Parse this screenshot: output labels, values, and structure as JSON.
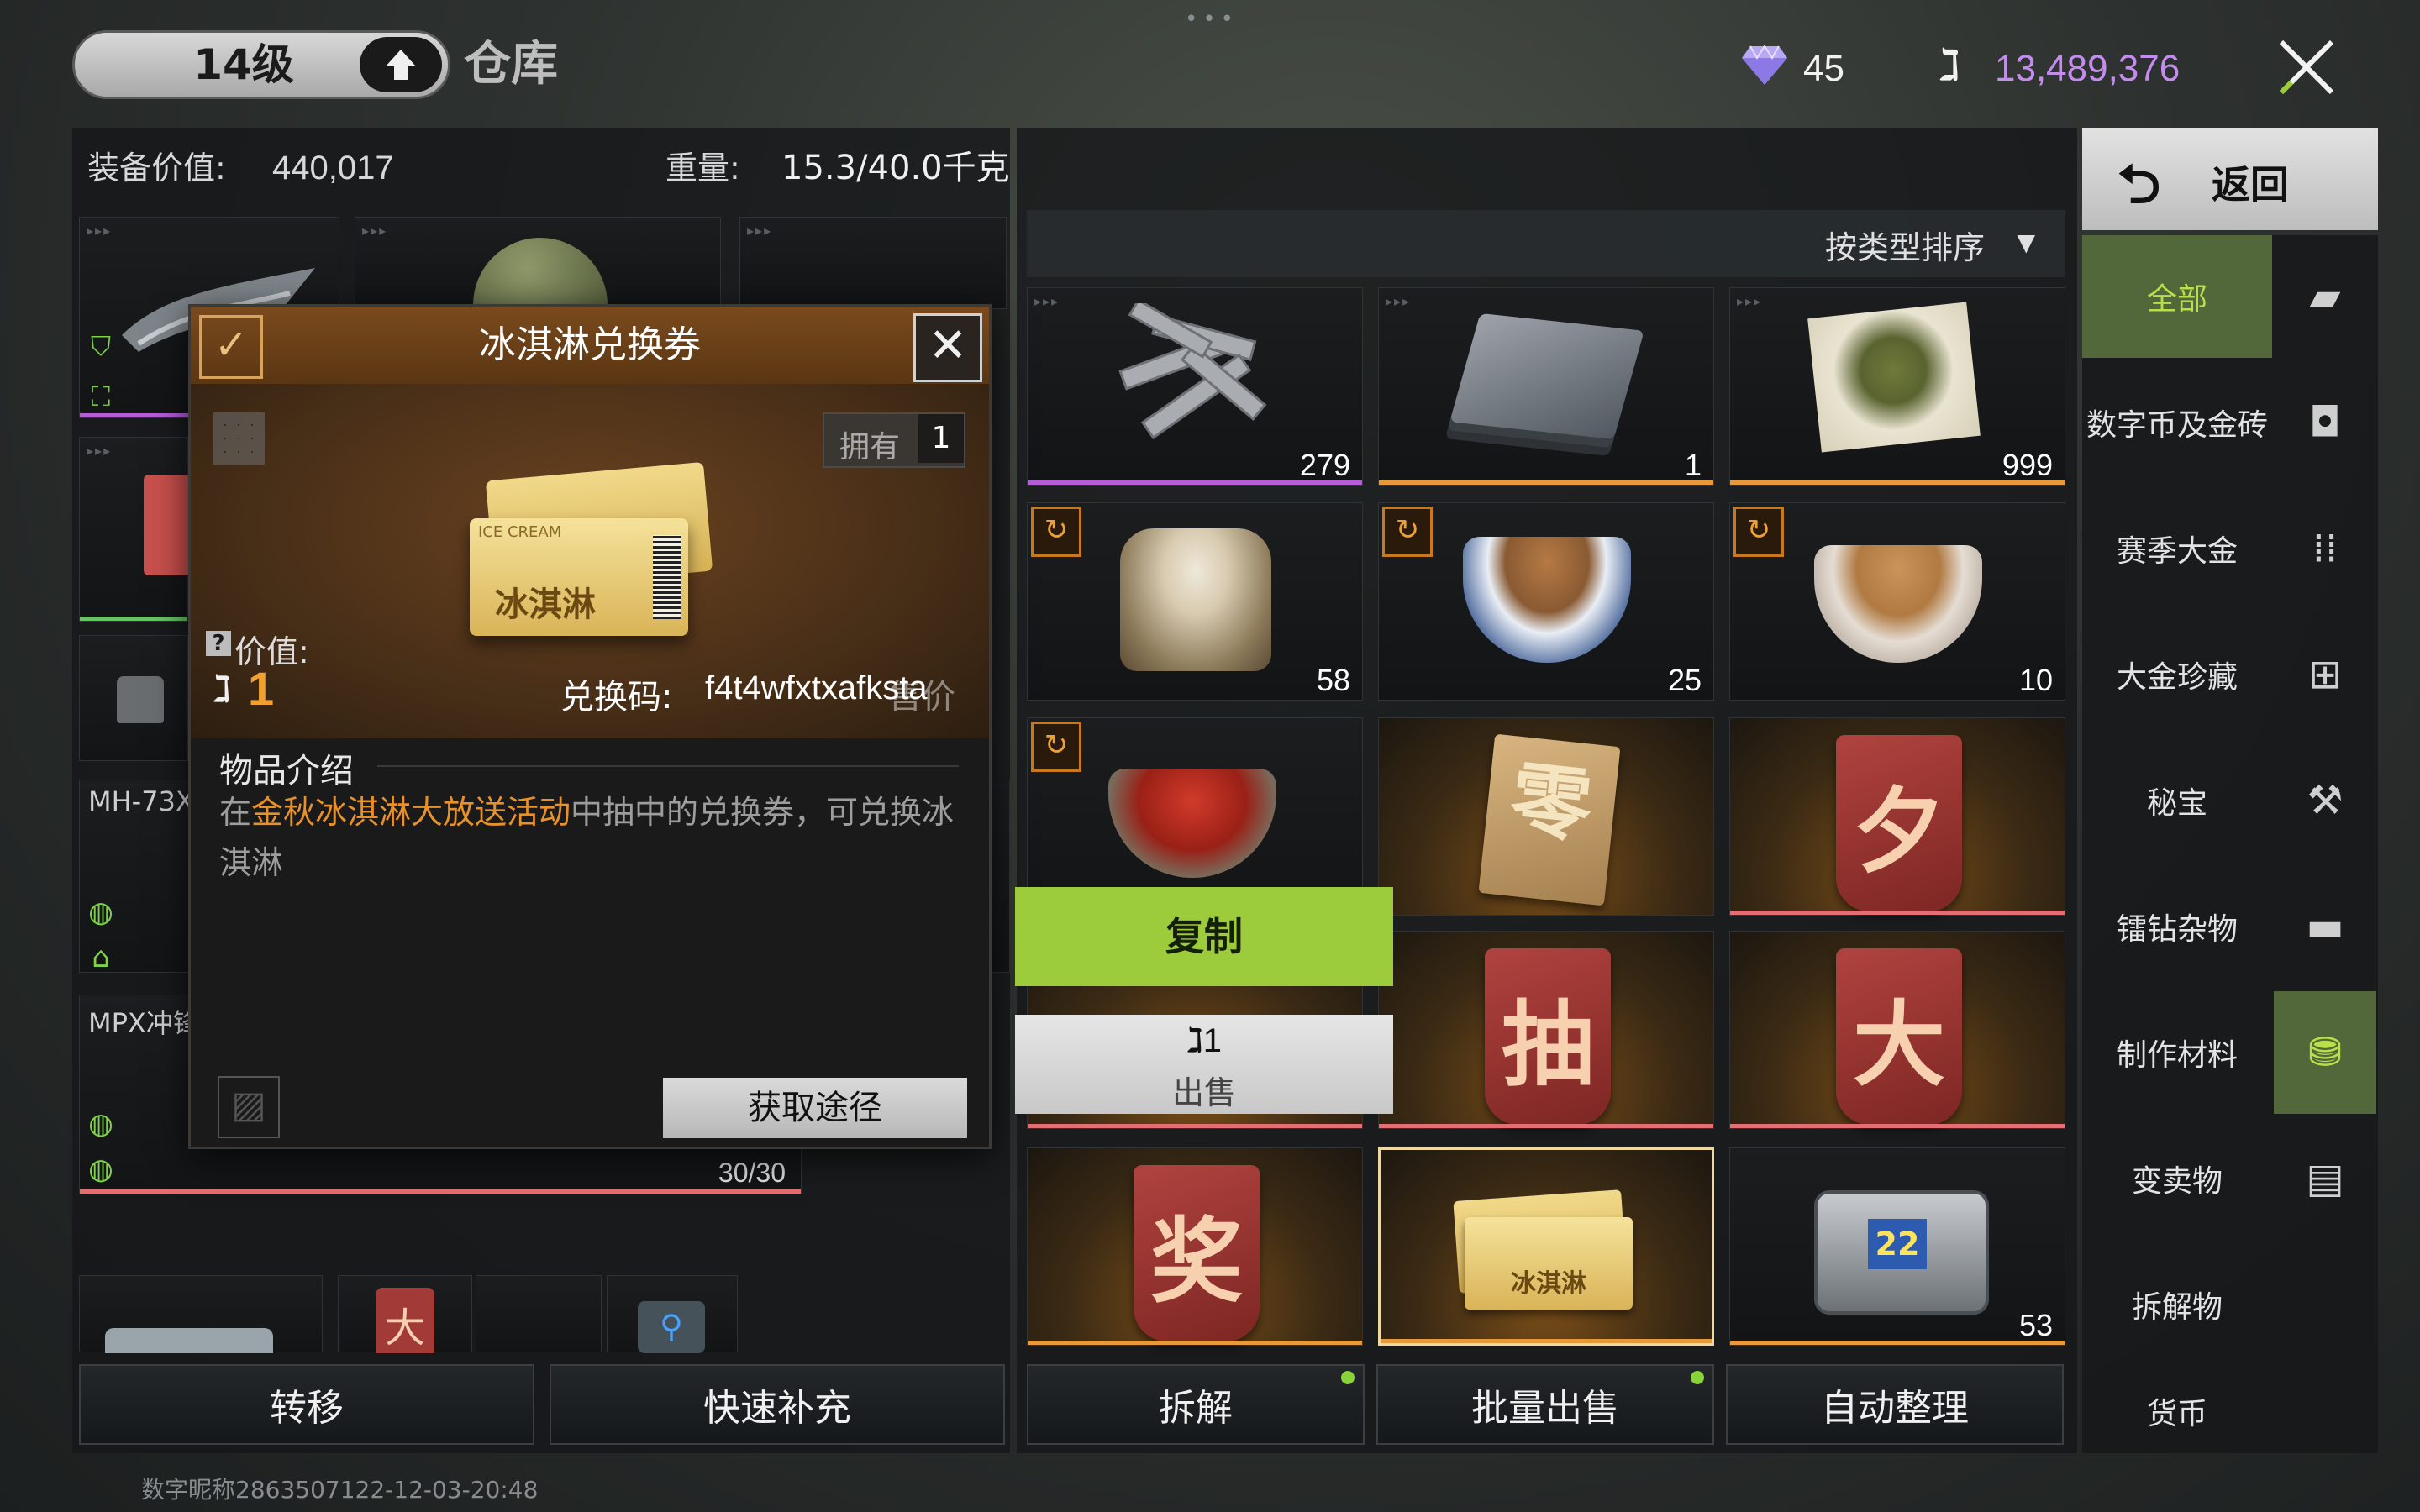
{
  "header": {
    "level": "14级",
    "title": "仓库",
    "diamonds": "45",
    "coins": "13,489,376"
  },
  "left": {
    "equip_label": "装备价值:",
    "equip_value": "440,017",
    "weight_label": "重量:",
    "weight_value": "15.3/40.0千克",
    "weapon1": "MH-73X",
    "weapon2": "MPX冲锋",
    "ammo": "30/30",
    "transfer": "转移",
    "refill": "快速补充"
  },
  "popup": {
    "title": "冰淇淋兑换券",
    "own_label": "拥有",
    "own_count": "1",
    "value_label": "价值:",
    "value": "1",
    "code_label": "兑换码:",
    "code": "f4t4wfxtxafksta",
    "code_overlap": "售价",
    "intro_heading": "物品介绍",
    "desc_pre": "在",
    "desc_highlight": "金秋冰淇淋大放送活动",
    "desc_post": "中抽中的兑换券，可兑换冰淇淋",
    "obtain_btn": "获取途径",
    "ticket_text": "冰淇淋",
    "ticket_band": "ICE CREAM"
  },
  "context": {
    "copy": "复制",
    "sell_price": "1",
    "sell": "出售"
  },
  "grid": {
    "sort_label": "按类型排序",
    "counts": [
      "279",
      "1",
      "999",
      "58",
      "25",
      "10",
      "53"
    ],
    "cards": [
      "零",
      "夕",
      "抽",
      "大",
      "奖",
      "大"
    ],
    "case_number": "22",
    "disassemble": "拆解",
    "bulk_sell": "批量出售",
    "auto_sort": "自动整理"
  },
  "sidebar": {
    "back": "返回",
    "items": [
      "全部",
      "数字币及金砖",
      "赛季大金",
      "大金珍藏",
      "秘宝",
      "镭钻杂物",
      "制作材料",
      "变卖物",
      "拆解物",
      "货币"
    ]
  },
  "footer": {
    "watermark": "数字昵称2863507122-12-03-20:48"
  },
  "colors": {
    "accent_green": "#9ccb3b",
    "orange_text": "#e8902a",
    "coin_purple": "#c58cf0",
    "selected_tab": "#53683a"
  }
}
